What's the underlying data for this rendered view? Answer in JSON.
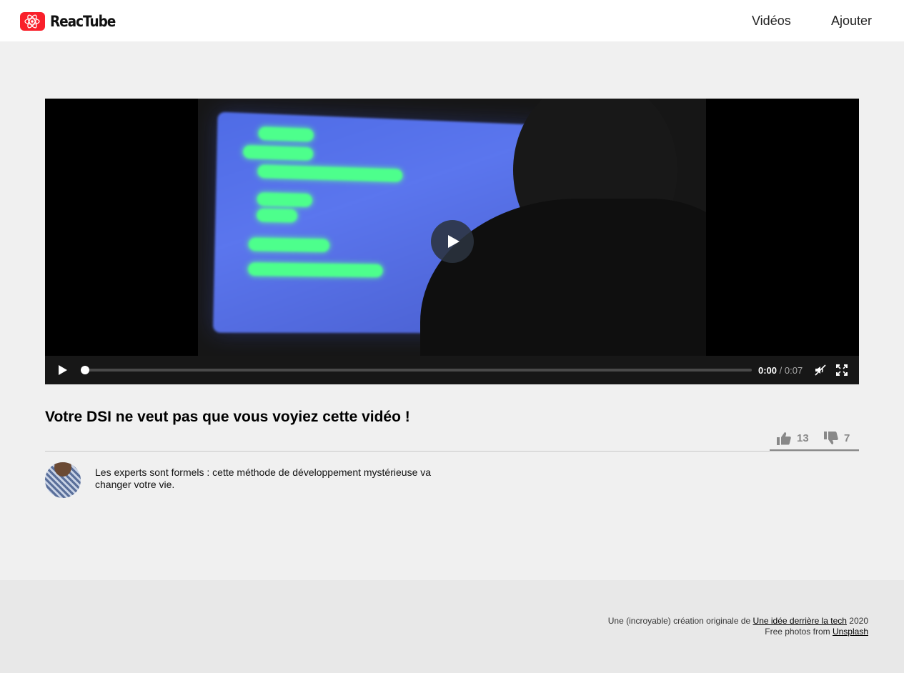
{
  "header": {
    "logo_text": "ReacTube",
    "nav": {
      "videos": "Vidéos",
      "add": "Ajouter"
    }
  },
  "video": {
    "current_time": "0:00",
    "separator": " / ",
    "duration": "0:07",
    "progress": 0
  },
  "details": {
    "title": "Votre DSI ne veut pas que vous voyiez cette vidéo !",
    "likes": "13",
    "dislikes": "7",
    "description": "Les experts sont formels : cette méthode de développement mystérieuse va changer votre vie."
  },
  "footer": {
    "line1_prefix": "Une (incroyable) création originale de ",
    "line1_link": "Une idée derrière la tech",
    "line1_suffix": " 2020",
    "line2_prefix": "Free photos from ",
    "line2_link": "Unsplash"
  },
  "colors": {
    "brand": "#f9202b",
    "background": "#f0f0f0",
    "footer": "#e8e8e8"
  },
  "icons": [
    "react-logo-icon",
    "play-icon",
    "mute-icon",
    "fullscreen-icon",
    "thumbs-up-icon",
    "thumbs-down-icon"
  ]
}
